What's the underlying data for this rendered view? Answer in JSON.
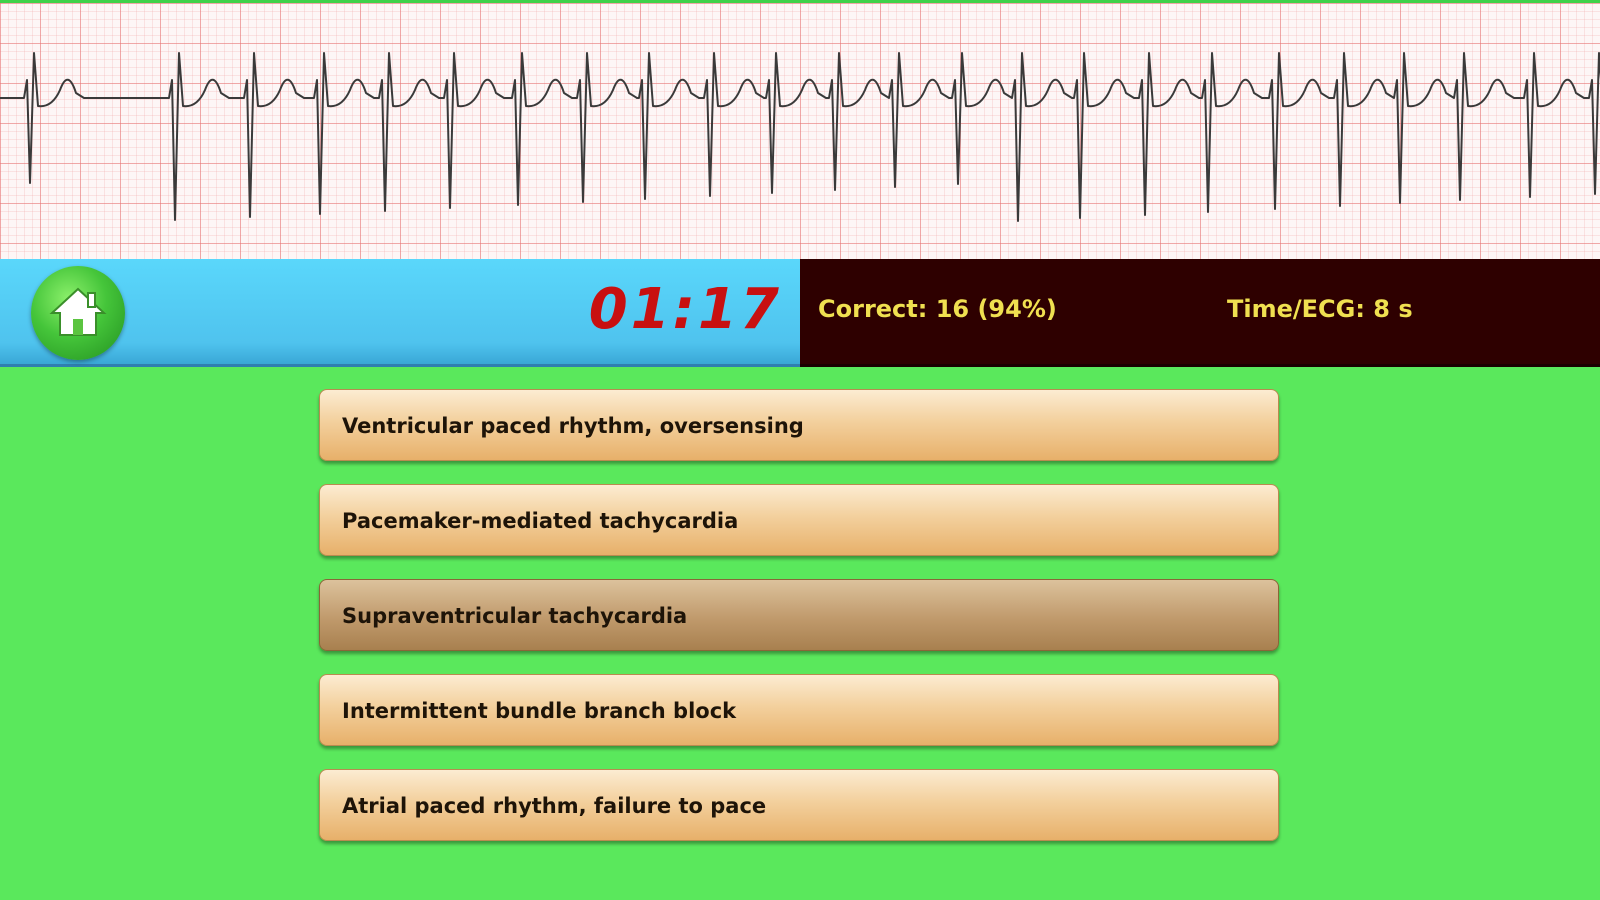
{
  "header": {
    "timer": "01:17",
    "correct": "Correct: 16 (94%)",
    "time_per_ecg": "Time/ECG: 8 s"
  },
  "icons": {
    "home": "home-icon"
  },
  "colors": {
    "background": "#5ae85c",
    "timer": "#c81010",
    "stats_text": "#f0e050",
    "stats_panel": "#2e0000",
    "timer_panel": "#5ad7fb"
  },
  "answers": [
    {
      "label": "Ventricular paced rhythm, oversensing",
      "selected": false
    },
    {
      "label": "Pacemaker-mediated tachycardia",
      "selected": false
    },
    {
      "label": "Supraventricular tachycardia",
      "selected": true
    },
    {
      "label": "Intermittent bundle branch block",
      "selected": false
    },
    {
      "label": "Atrial paced rhythm, failure to pace",
      "selected": false
    }
  ]
}
